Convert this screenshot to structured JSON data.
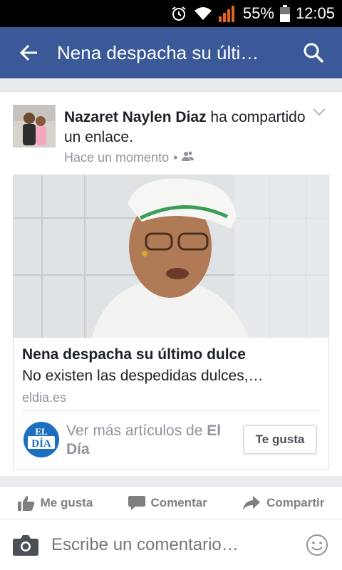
{
  "status": {
    "battery": "55%",
    "time": "12:05"
  },
  "header": {
    "title": "Nena despacha su últi…"
  },
  "post": {
    "author": "Nazaret Naylen Diaz",
    "action": " ha compartido un enlace.",
    "time": "Hace un momento",
    "link": {
      "title": "Nena despacha su último dulce",
      "description": "No existen las despedidas dulces,…",
      "domain": "eldia.es",
      "more_prefix": "Ver más artículos de ",
      "publisher": "El Día",
      "like_button": "Te gusta",
      "logo_top": "EL",
      "logo_bottom": "DÍA"
    }
  },
  "actions": {
    "like": "Me gusta",
    "comment": "Comentar",
    "share": "Compartir"
  },
  "comment": {
    "placeholder": "Escribe un comentario…"
  },
  "colors": {
    "appbar": "#3b5998",
    "statusbar": "#000000",
    "action_text": "#7f7f7f"
  }
}
